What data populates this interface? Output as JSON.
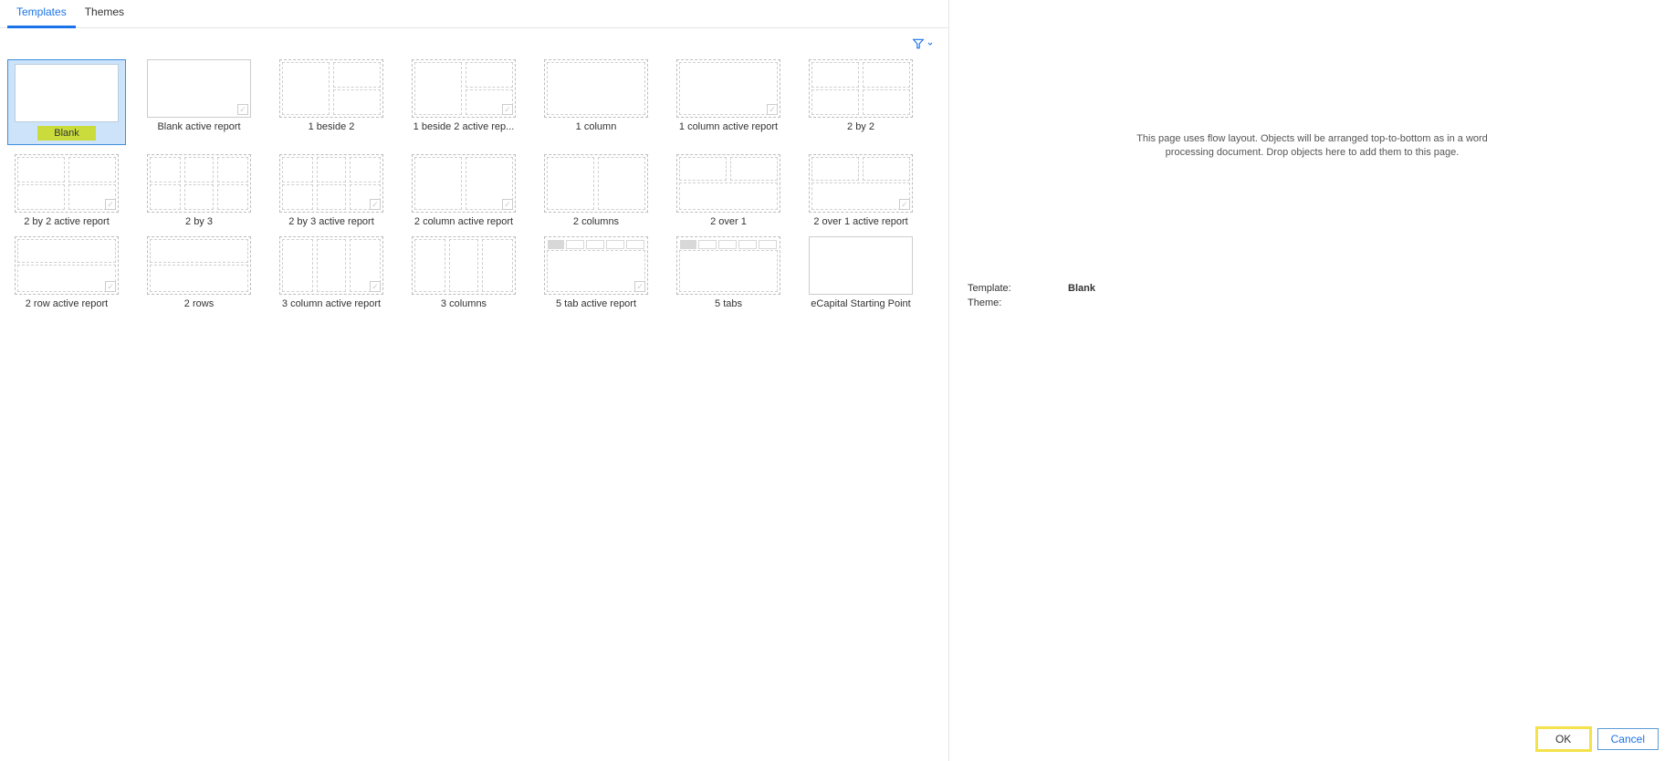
{
  "tabs": {
    "templates": "Templates",
    "themes": "Themes",
    "active": "templates"
  },
  "filter": {
    "tooltip": "Filter"
  },
  "templates": [
    {
      "id": "blank",
      "label": "Blank",
      "layout": "solid",
      "active_badge": false,
      "selected": true
    },
    {
      "id": "blank-active",
      "label": "Blank active report",
      "layout": "solid",
      "active_badge": true
    },
    {
      "id": "1beside2",
      "label": "1 beside 2",
      "layout": "1b2",
      "active_badge": false
    },
    {
      "id": "1beside2-active",
      "label": "1 beside 2 active rep...",
      "layout": "1b2",
      "active_badge": true
    },
    {
      "id": "1column",
      "label": "1 column",
      "layout": "1col",
      "active_badge": false
    },
    {
      "id": "1column-active",
      "label": "1 column active report",
      "layout": "1col",
      "active_badge": true
    },
    {
      "id": "2by2",
      "label": "2 by 2",
      "layout": "2x2",
      "active_badge": false
    },
    {
      "id": "2by2-active",
      "label": "2 by 2 active report",
      "layout": "2x2",
      "active_badge": true
    },
    {
      "id": "2by3",
      "label": "2 by 3",
      "layout": "2x3",
      "active_badge": false
    },
    {
      "id": "2by3-active",
      "label": "2 by 3 active report",
      "layout": "2x3",
      "active_badge": true
    },
    {
      "id": "2col-active",
      "label": "2 column active report",
      "layout": "2col",
      "active_badge": true
    },
    {
      "id": "2col",
      "label": "2 columns",
      "layout": "2col",
      "active_badge": false
    },
    {
      "id": "2over1",
      "label": "2 over 1",
      "layout": "2o1",
      "active_badge": false
    },
    {
      "id": "2over1-active",
      "label": "2 over 1 active report",
      "layout": "2o1",
      "active_badge": true
    },
    {
      "id": "2row-active",
      "label": "2 row active report",
      "layout": "2row",
      "active_badge": true
    },
    {
      "id": "2rows",
      "label": "2 rows",
      "layout": "2row",
      "active_badge": false
    },
    {
      "id": "3col-active",
      "label": "3 column active report",
      "layout": "3col",
      "active_badge": true
    },
    {
      "id": "3col",
      "label": "3 columns",
      "layout": "3col",
      "active_badge": false
    },
    {
      "id": "5tab-active",
      "label": "5 tab active report",
      "layout": "5tab",
      "active_badge": true
    },
    {
      "id": "5tab",
      "label": "5 tabs",
      "layout": "5tab",
      "active_badge": false
    },
    {
      "id": "ecap",
      "label": "eCapital Starting Point",
      "layout": "solid",
      "active_badge": false
    }
  ],
  "preview": {
    "description": "This page uses flow layout. Objects will be arranged top-to-bottom as in a word processing document. Drop objects here to add them to this page.",
    "template_label": "Template:",
    "template_value": "Blank",
    "theme_label": "Theme:",
    "theme_value": ""
  },
  "buttons": {
    "ok": "OK",
    "cancel": "Cancel"
  }
}
